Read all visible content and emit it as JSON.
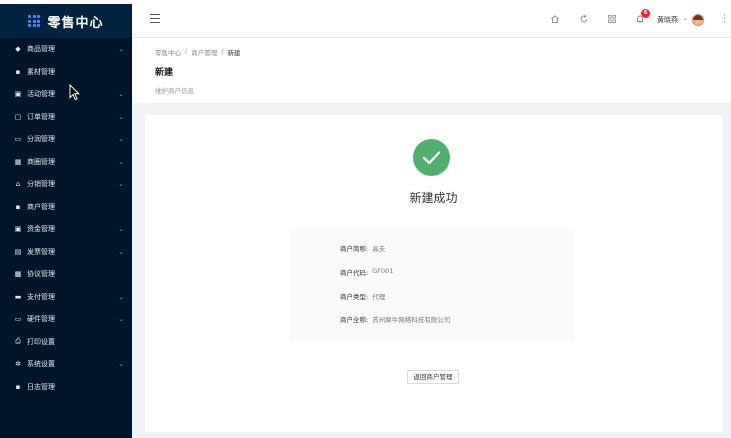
{
  "app": {
    "title": "零售中心"
  },
  "sidebar": {
    "items": [
      {
        "label": "商品管理",
        "icon": "tag-icon",
        "glyph": "◆",
        "expand": true
      },
      {
        "label": "素材管理",
        "icon": "file-icon",
        "glyph": "▪",
        "expand": false
      },
      {
        "label": "活动管理",
        "icon": "calendar-icon",
        "glyph": "▣",
        "expand": true
      },
      {
        "label": "订单管理",
        "icon": "order-icon",
        "glyph": "▢",
        "expand": true
      },
      {
        "label": "分润管理",
        "icon": "monitor-icon",
        "glyph": "▭",
        "expand": true
      },
      {
        "label": "商圈管理",
        "icon": "grid-icon",
        "glyph": "▦",
        "expand": true
      },
      {
        "label": "分销管理",
        "icon": "home-icon",
        "glyph": "⌂",
        "expand": true
      },
      {
        "label": "商户管理",
        "icon": "idcard-icon",
        "glyph": "▪",
        "expand": false
      },
      {
        "label": "资金管理",
        "icon": "wallet-icon",
        "glyph": "▣",
        "expand": true
      },
      {
        "label": "发票管理",
        "icon": "invoice-icon",
        "glyph": "▤",
        "expand": true
      },
      {
        "label": "协议管理",
        "icon": "contract-icon",
        "glyph": "▩",
        "expand": false
      },
      {
        "label": "支付管理",
        "icon": "card-icon",
        "glyph": "▬",
        "expand": true
      },
      {
        "label": "硬件管理",
        "icon": "device-icon",
        "glyph": "▭",
        "expand": true
      },
      {
        "label": "打印设置",
        "icon": "printer-icon",
        "glyph": "⎙",
        "expand": false
      },
      {
        "label": "系统设置",
        "icon": "gear-icon",
        "glyph": "✲",
        "expand": true
      },
      {
        "label": "日志管理",
        "icon": "log-icon",
        "glyph": "▪",
        "expand": false
      }
    ]
  },
  "header": {
    "notification_count": "6",
    "username": "黄晓燕"
  },
  "breadcrumb": [
    "零售中心",
    "商户管理",
    "新建"
  ],
  "page": {
    "title": "新建",
    "subtitle": "维护商户信息"
  },
  "result": {
    "title": "新建成功",
    "rows": [
      {
        "label": "商户简称:",
        "value": "高夫"
      },
      {
        "label": "商户代码:",
        "value": "GF001"
      },
      {
        "label": "商户类型:",
        "value": "代理"
      },
      {
        "label": "商户全称:",
        "value": "苏州犀牛网络科技有限公司"
      }
    ],
    "back_button": "返回商户管理"
  },
  "colors": {
    "sidebar_bg": "#001529",
    "success": "#52b06f",
    "badge": "#f5222d"
  }
}
